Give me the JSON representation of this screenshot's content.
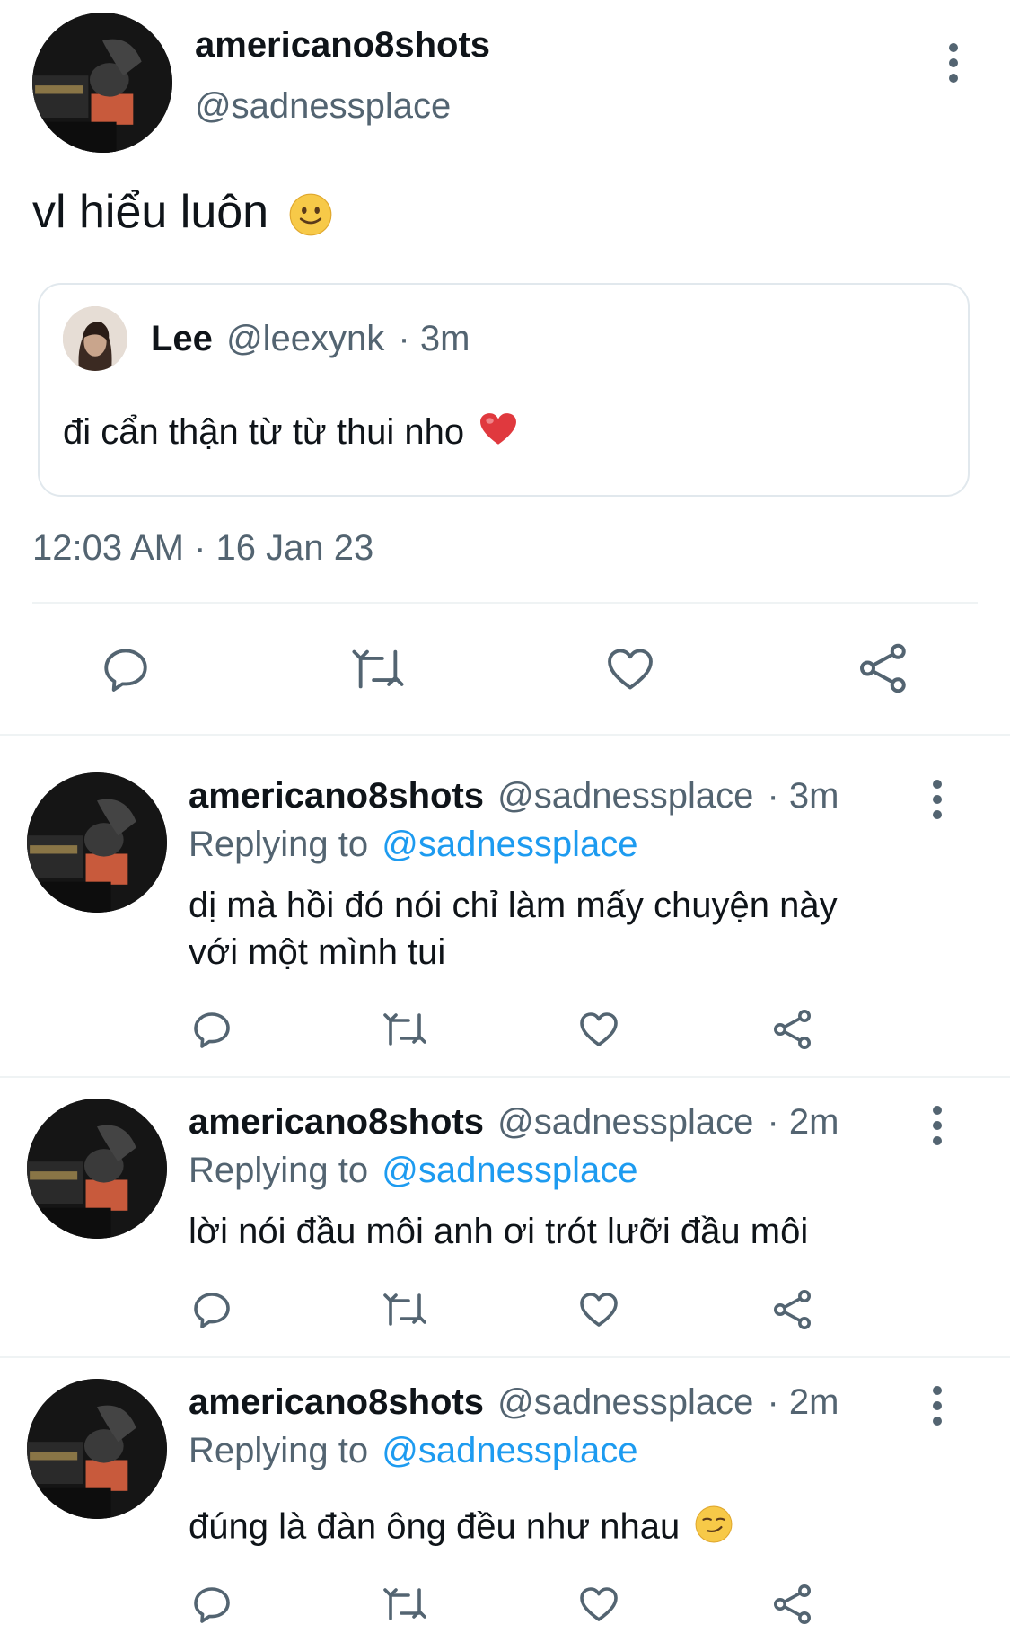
{
  "main_tweet": {
    "display_name": "americano8shots",
    "handle": "@sadnessplace",
    "text": "vl hiểu luôn",
    "emoji": "slightly-smiling-face",
    "quoted": {
      "display_name": "Lee",
      "handle": "@leexynk",
      "time": "· 3m",
      "text": "đi cẩn thận từ từ thui nho",
      "emoji": "red-heart"
    },
    "timestamp": "12:03 AM · 16 Jan 23"
  },
  "replies": [
    {
      "display_name": "americano8shots",
      "handle": "@sadnessplace",
      "time": "· 3m",
      "replying_prefix": "Replying to",
      "replying_to": "@sadnessplace",
      "text_line1": "dị mà hồi đó nói chỉ làm mấy chuyện này",
      "text_line2": "với một mình tui"
    },
    {
      "display_name": "americano8shots",
      "handle": "@sadnessplace",
      "time": "· 2m",
      "replying_prefix": "Replying to",
      "replying_to": "@sadnessplace",
      "text_line1": "lời nói đầu môi anh ơi trót lưỡi đầu môi",
      "text_line2": ""
    },
    {
      "display_name": "americano8shots",
      "handle": "@sadnessplace",
      "time": "· 2m",
      "replying_prefix": "Replying to",
      "replying_to": "@sadnessplace",
      "text_line1": "đúng là đàn ông đều như nhau",
      "text_line2": "",
      "emoji": "smirking-face"
    }
  ],
  "colors": {
    "text": "#0f1419",
    "secondary": "#536471",
    "link": "#1d9bf0",
    "border": "#eff3f4"
  }
}
